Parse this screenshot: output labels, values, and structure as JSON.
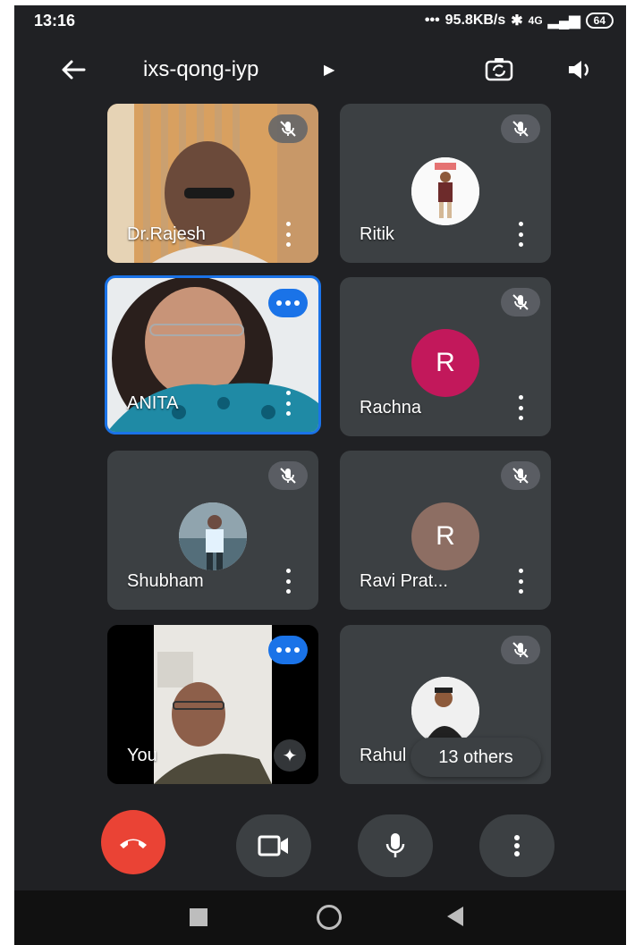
{
  "status_bar": {
    "time": "13:16",
    "network_speed": "95.8KB/s",
    "network_type": "4G",
    "battery": "64"
  },
  "header": {
    "meeting_code": "ixs-qong-iyp",
    "icons": [
      "back-arrow-icon",
      "switch-camera-icon",
      "speaker-icon"
    ]
  },
  "participants": [
    {
      "name": "Dr.Rajesh",
      "muted": true,
      "video": true
    },
    {
      "name": "Ritik",
      "muted": true,
      "video": false,
      "avatar": "photo"
    },
    {
      "name": "ANITA",
      "muted": false,
      "speaking": true,
      "video": true
    },
    {
      "name": "Rachna",
      "muted": true,
      "video": false,
      "initial": "R",
      "avatar_color": "#c2185b"
    },
    {
      "name": "Shubham",
      "muted": true,
      "video": false,
      "avatar": "photo"
    },
    {
      "name": "Ravi Prat...",
      "muted": true,
      "video": false,
      "initial": "R",
      "avatar_color": "#8d6e63"
    },
    {
      "name": "You",
      "muted": false,
      "speaking": true,
      "video": true
    },
    {
      "name": "Rahul",
      "muted": true,
      "video": false,
      "avatar": "photo"
    }
  ],
  "others_pill": "13 others",
  "controls": [
    "end-call",
    "camera",
    "microphone",
    "more-options"
  ],
  "colors": {
    "background": "#202124",
    "tile": "#3c4043",
    "accent": "#1a73e8",
    "end_call": "#ea4335"
  }
}
